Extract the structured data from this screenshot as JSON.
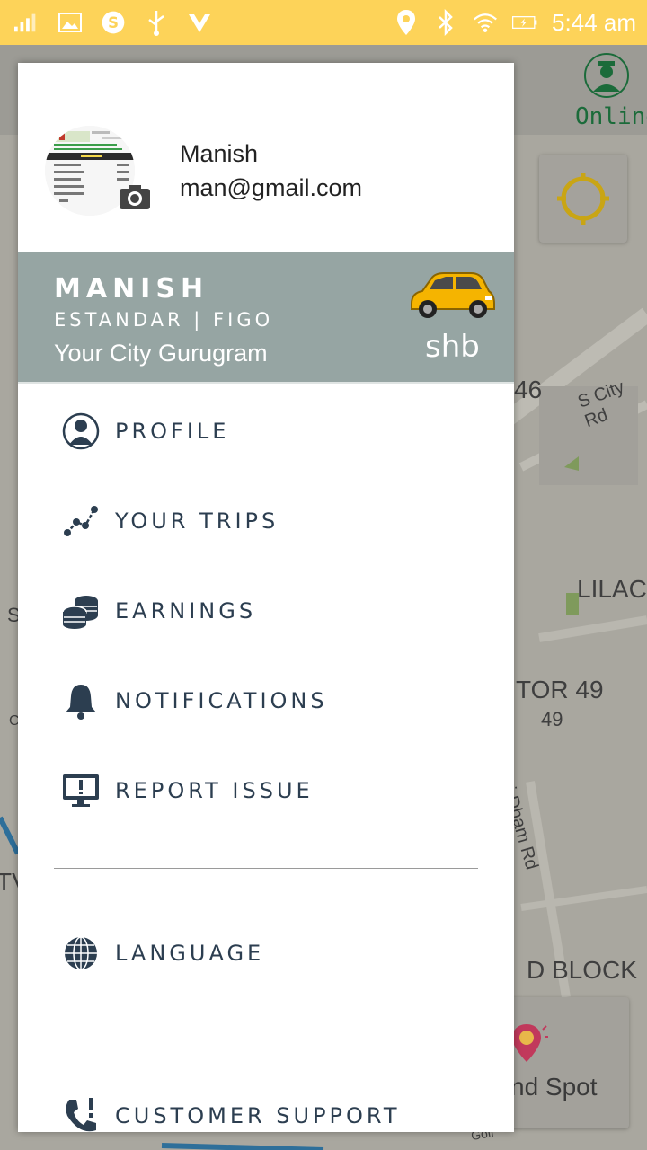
{
  "status_bar": {
    "time": "5:44 am",
    "left_icons": [
      "signal-icon",
      "gallery-icon",
      "skype-icon",
      "usb-icon",
      "vpn-icon"
    ],
    "right_icons": [
      "location-icon",
      "bluetooth-icon",
      "wifi-icon",
      "battery-icon"
    ]
  },
  "map": {
    "online_label": "Online",
    "labels": {
      "road_46": "46",
      "city_rd": "S City Rd",
      "lilac": "LILAC",
      "sector_49": "TOR 49",
      "num_49": "49",
      "sai_dham": "Sai Dham Rd",
      "d_block": "D BLOCK",
      "spot": "nd Spot",
      "left_s": "S",
      "left_tv": "TV",
      "left_c": "C",
      "golf": "Golf"
    }
  },
  "drawer": {
    "user": {
      "name": "Manish",
      "email": "man@gmail.com"
    },
    "banner": {
      "name": "MANISH",
      "subtitle": "ESTANDAR | FIGO",
      "city": "Your City Gurugram",
      "brand": "shb"
    },
    "menu": [
      {
        "label": "PROFILE",
        "icon": "user-icon"
      },
      {
        "label": "YOUR TRIPS",
        "icon": "route-icon"
      },
      {
        "label": "EARNINGS",
        "icon": "coins-icon"
      },
      {
        "label": "NOTIFICATIONS",
        "icon": "bell-icon"
      },
      {
        "label": "REPORT ISSUE",
        "icon": "monitor-alert-icon"
      },
      {
        "label": "LANGUAGE",
        "icon": "globe-icon"
      },
      {
        "label": "CUSTOMER SUPPORT",
        "icon": "phone-alert-icon"
      }
    ]
  },
  "colors": {
    "status_bar": "#fdd359",
    "banner": "#96a5a3",
    "menu_text": "#2c3e50",
    "online": "#1b6b3a"
  }
}
